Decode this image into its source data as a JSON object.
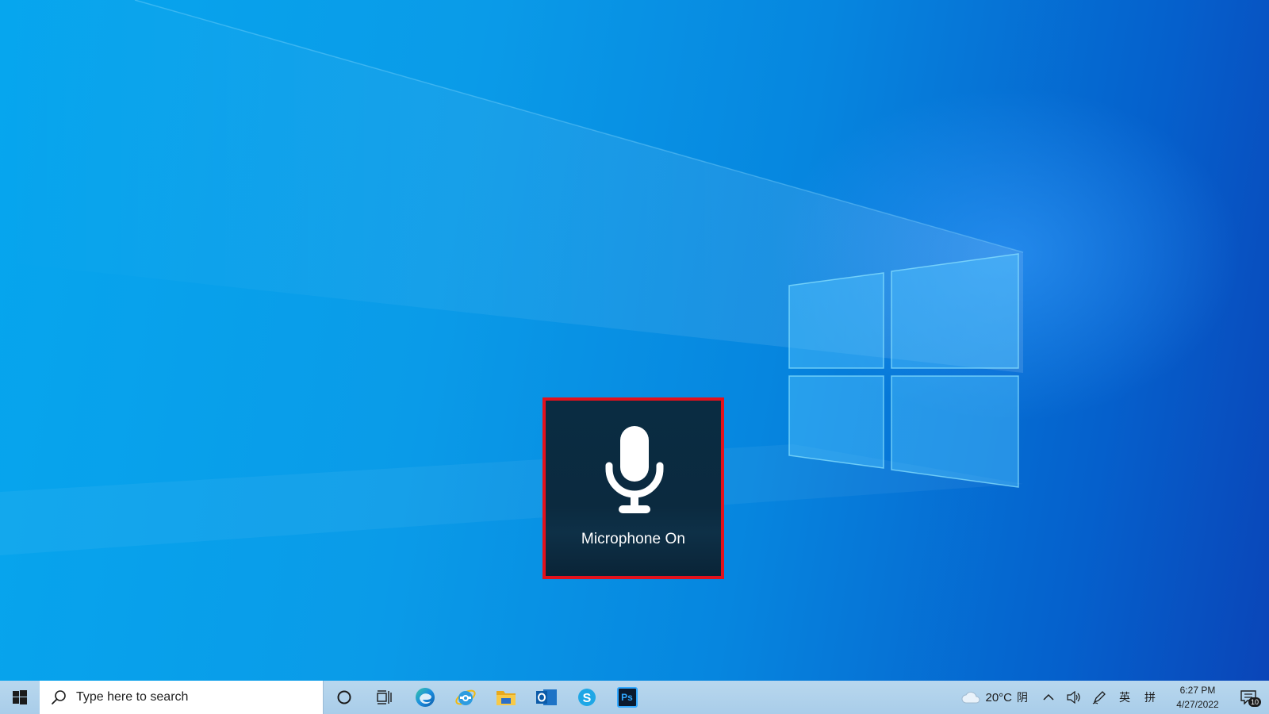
{
  "osd": {
    "label": "Microphone On",
    "icon": "microphone-icon",
    "highlight_color": "#e3111c"
  },
  "taskbar": {
    "search_placeholder": "Type here to search",
    "pinned_apps": [
      "cortana",
      "task-view",
      "edge",
      "internet-explorer",
      "file-explorer",
      "outlook",
      "skype",
      "photoshop"
    ],
    "photoshop_label": "Ps"
  },
  "tray": {
    "weather_temp": "20°C",
    "weather_condition": "阴",
    "ime_language": "英",
    "ime_mode": "拼",
    "time": "6:27 PM",
    "date": "4/27/2022",
    "notification_count": "10"
  }
}
